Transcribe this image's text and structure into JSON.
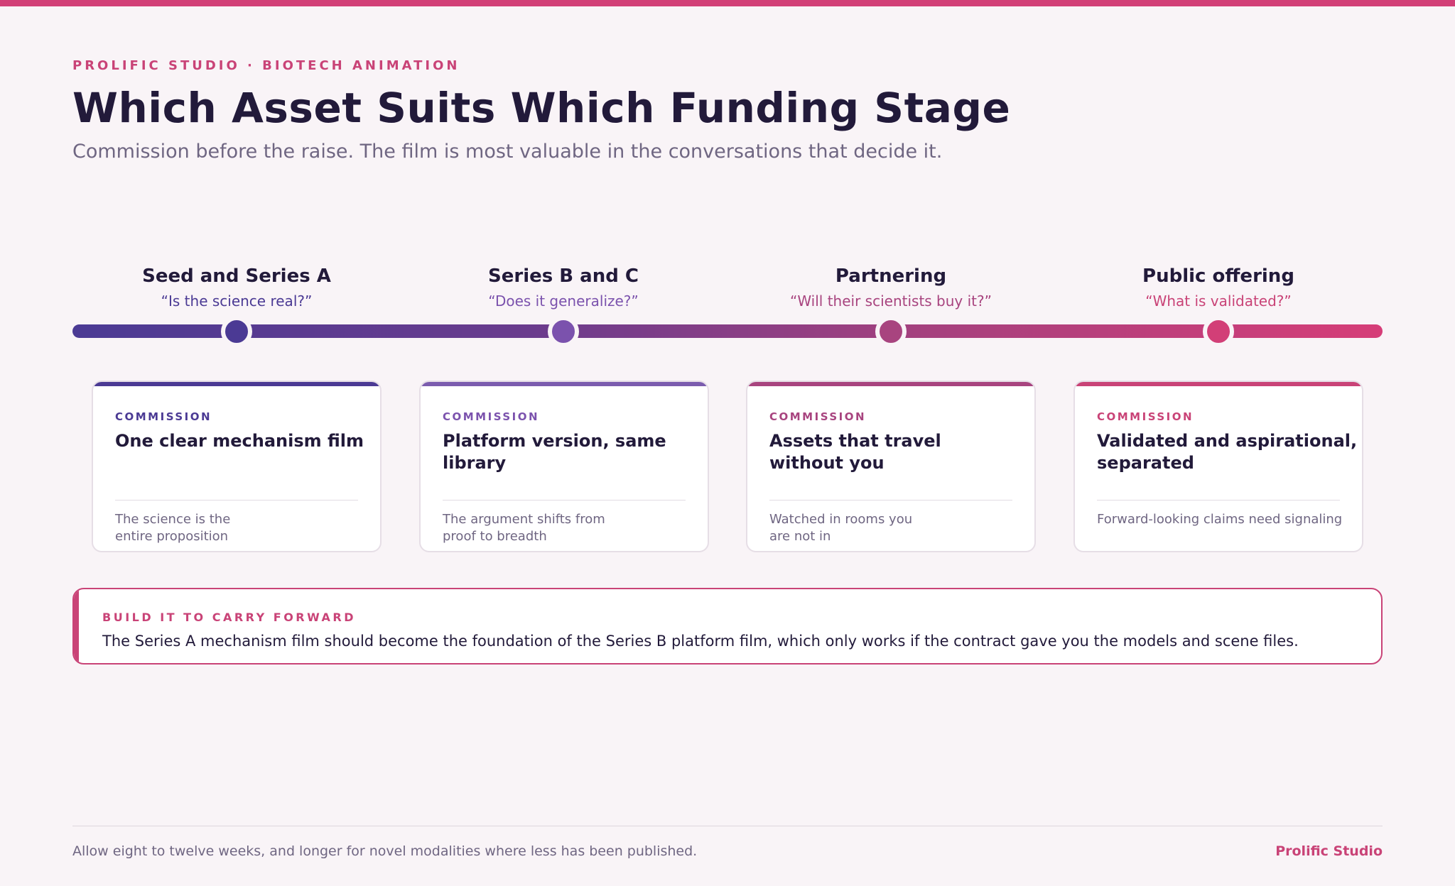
{
  "header": {
    "eyebrow": "PROLIFIC STUDIO · BIOTECH ANIMATION",
    "title": "Which Asset Suits Which Funding Stage",
    "subtitle": "Commission before the raise. The film is most valuable in the conversations that decide it."
  },
  "stages": [
    {
      "name": "Seed and Series A",
      "question": "“Is the science real?”",
      "color": "#4b3a94",
      "question_color": "#4b3a94",
      "card": {
        "eyebrow": "COMMISSION",
        "title": "One clear mechanism film",
        "note": "The science is the entire proposition"
      }
    },
    {
      "name": "Series B and C",
      "question": "“Does it generalize?”",
      "color": "#7b52ad",
      "question_color": "#7b52ad",
      "card": {
        "eyebrow": "COMMISSION",
        "title": "Platform version, same library",
        "note": "The argument shifts from proof to breadth"
      }
    },
    {
      "name": "Partnering",
      "question": "“Will their scientists buy it?”",
      "color": "#a8447f",
      "question_color": "#a8447f",
      "card": {
        "eyebrow": "COMMISSION",
        "title": "Assets that travel without you",
        "note": "Watched in rooms you are not in"
      }
    },
    {
      "name": "Public offering",
      "question": "“What is validated?”",
      "color": "#d23f77",
      "question_color": "#c94377",
      "card": {
        "eyebrow": "COMMISSION",
        "title": "Validated and aspirational, separated",
        "note": "Forward-looking claims need signaling"
      }
    }
  ],
  "callout": {
    "eyebrow": "BUILD IT TO CARRY FORWARD",
    "text": "The Series A mechanism film should become the foundation of the Series B platform film, which only works if the contract gave you the models and scene files."
  },
  "footer": {
    "note": "Allow eight to twelve weeks, and longer for novel modalities where less has been published.",
    "brand": "Prolific Studio"
  }
}
